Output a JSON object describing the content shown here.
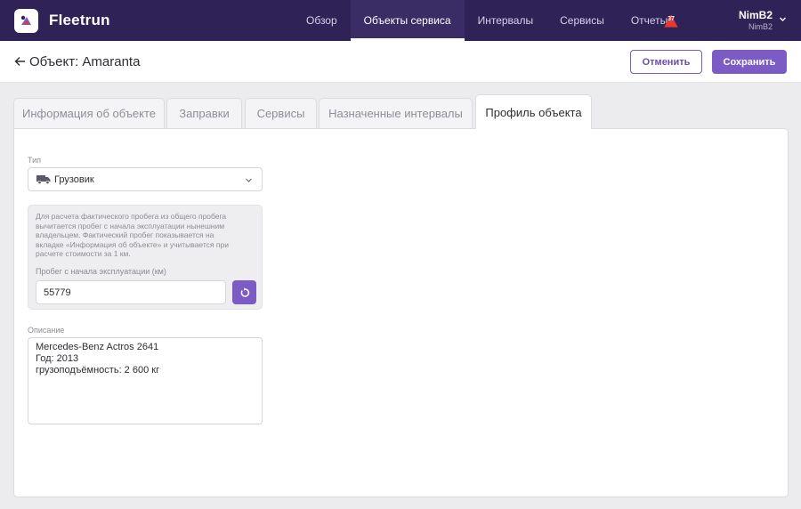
{
  "app": {
    "name": "Fleetrun"
  },
  "nav": {
    "items": [
      {
        "label": "Обзор",
        "active": false
      },
      {
        "label": "Объекты сервиса",
        "active": true
      },
      {
        "label": "Интервалы",
        "active": false
      },
      {
        "label": "Сервисы",
        "active": false
      },
      {
        "label": "Отчеты",
        "active": false
      }
    ],
    "notification_count": "37"
  },
  "user": {
    "name": "NimB2",
    "account": "NimB2"
  },
  "header": {
    "title": "Объект: Amaranta",
    "cancel_label": "Отменить",
    "save_label": "Сохранить"
  },
  "tabs": [
    {
      "label": "Информация об объекте",
      "active": false
    },
    {
      "label": "Заправки",
      "active": false
    },
    {
      "label": "Сервисы",
      "active": false
    },
    {
      "label": "Назначенные интервалы",
      "active": false
    },
    {
      "label": "Профиль объекта",
      "active": true
    }
  ],
  "form": {
    "type": {
      "label": "Тип",
      "value": "Грузовик",
      "icon": "truck-icon"
    },
    "mileage_info": {
      "lines": [
        "Для расчета фактического пробега из общего пробега",
        "вычитается пробег с начала эксплуатации нынешним",
        "владельцем. Фактический пробег показывается на",
        "вкладке «Информация об объекте» и учитывается при",
        "расчете стоимости за 1 км."
      ],
      "field_label": "Пробег с начала эксплуатации (км)",
      "value": "55779"
    },
    "description": {
      "label": "Описание",
      "lines": [
        "Mercedes-Benz Actros 2641",
        "Год: 2013",
        "грузоподъёмность: 2 600 кг"
      ]
    }
  },
  "colors": {
    "topbar": "#2e2256",
    "accent": "#7c5cc4",
    "notification": "#e53935"
  }
}
